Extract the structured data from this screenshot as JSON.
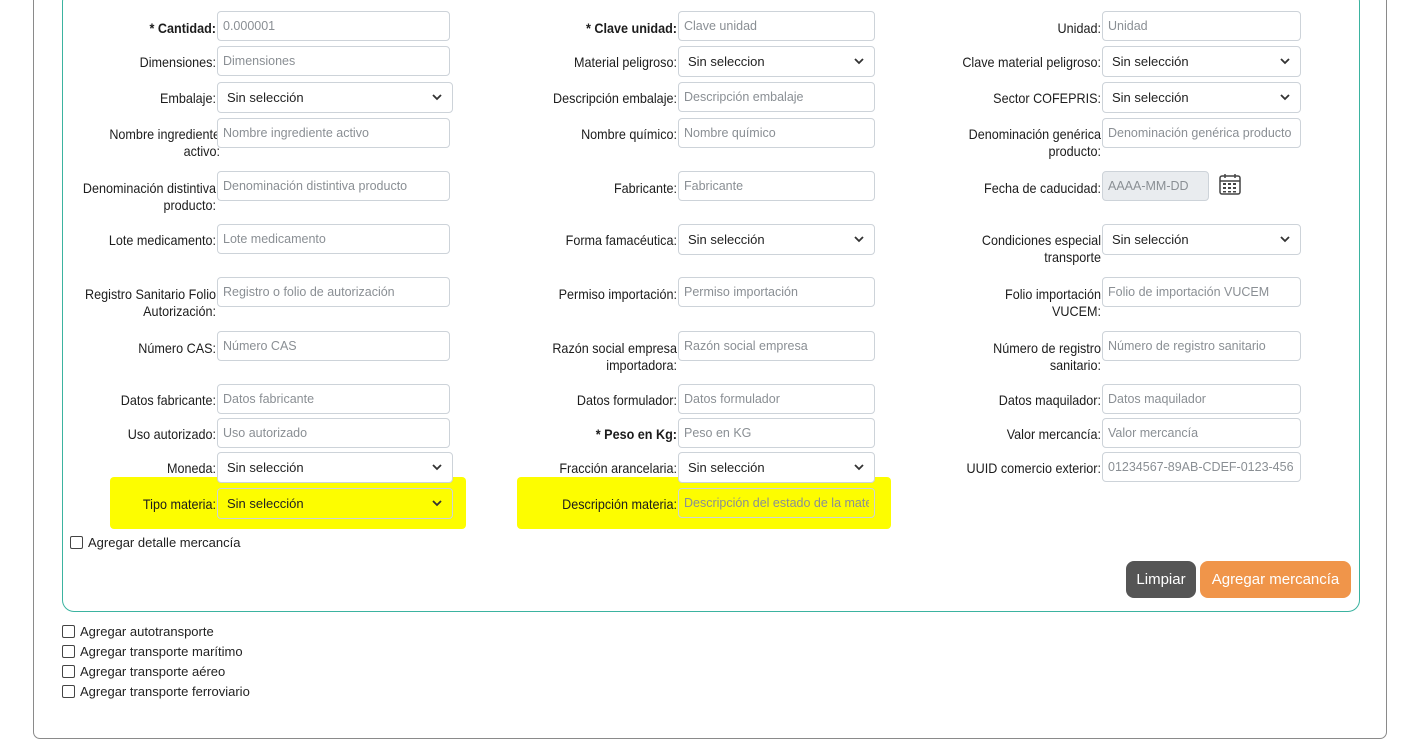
{
  "labels": {
    "cantidad": "* Cantidad:",
    "clave_unidad": "* Clave unidad:",
    "unidad": "Unidad:",
    "dimensiones": "Dimensiones:",
    "material_peligroso": "Material peligroso:",
    "clave_material_peligroso": "Clave material peligroso:",
    "embalaje": "Embalaje:",
    "descripcion_embalaje": "Descripción embalaje:",
    "sector_cofepris": "Sector COFEPRIS:",
    "nombre_ingrediente": "Nombre ingrediente activo:",
    "nombre_quimico": "Nombre químico:",
    "denominacion_generica": "Denominación genérica producto:",
    "denominacion_distintiva": "Denominación distintiva producto:",
    "fabricante": "Fabricante:",
    "fecha_caducidad": "Fecha de caducidad:",
    "lote_medicamento": "Lote medicamento:",
    "forma_farmaceutica": "Forma famacéutica:",
    "condiciones_transporte": "Condiciones especial transporte",
    "registro_sanitario": "Registro Sanitario Folio Autorización:",
    "permiso_importacion": "Permiso importación:",
    "folio_importacion": "Folio importación VUCEM:",
    "numero_cas": "Número CAS:",
    "razon_social": "Razón social empresa importadora:",
    "numero_registro": "Número de registro sanitario:",
    "datos_fabricante": "Datos fabricante:",
    "datos_formulador": "Datos formulador:",
    "datos_maquilador": "Datos maquilador:",
    "uso_autorizado": "Uso autorizado:",
    "peso_kg": "* Peso en Kg:",
    "valor_mercancia": "Valor mercancía:",
    "moneda": "Moneda:",
    "fraccion_arancelaria": "Fracción arancelaria:",
    "uuid_comercio": "UUID comercio exterior:",
    "tipo_materia": "Tipo materia:",
    "descripcion_materia": "Descripción materia:"
  },
  "placeholders": {
    "cantidad": "0.000001",
    "clave_unidad": "Clave unidad",
    "unidad": "Unidad",
    "dimensiones": "Dimensiones",
    "descripcion_embalaje": "Descripción embalaje",
    "nombre_ingrediente": "Nombre ingrediente activo",
    "nombre_quimico": "Nombre químico",
    "denominacion_generica": "Denominación genérica producto",
    "denominacion_distintiva": "Denominación distintiva producto",
    "fabricante": "Fabricante",
    "fecha_caducidad": "AAAA-MM-DD",
    "lote_medicamento": "Lote medicamento",
    "registro_sanitario": "Registro o folio de autorización",
    "permiso_importacion": "Permiso importación",
    "folio_importacion": "Folio de importación VUCEM",
    "numero_cas": "Número CAS",
    "razon_social": "Razón social empresa",
    "numero_registro": "Número de registro sanitario",
    "datos_fabricante": "Datos fabricante",
    "datos_formulador": "Datos formulador",
    "datos_maquilador": "Datos maquilador",
    "uso_autorizado": "Uso autorizado",
    "peso_kg": "Peso en KG",
    "valor_mercancia": "Valor mercancía",
    "uuid_comercio": "01234567-89AB-CDEF-0123-456",
    "descripcion_materia": "Descripción del estado de la mate"
  },
  "selects": {
    "material_peligroso": "Sin seleccion",
    "clave_material_peligroso": "Sin selección",
    "embalaje": "Sin selección",
    "sector_cofepris": "Sin selección",
    "forma_farmaceutica": "Sin selección",
    "condiciones_transporte": "Sin selección",
    "moneda": "Sin selección",
    "fraccion_arancelaria": "Sin selección",
    "tipo_materia": "Sin selección"
  },
  "checkboxes": {
    "detalle_mercancia": "Agregar detalle mercancía",
    "autotransporte": "Agregar autotransporte",
    "transporte_maritimo": "Agregar transporte marítimo",
    "transporte_aereo": "Agregar transporte aéreo",
    "transporte_ferroviario": "Agregar transporte ferroviario"
  },
  "buttons": {
    "limpiar": "Limpiar",
    "agregar_mercancia": "Agregar mercancía"
  },
  "colors": {
    "border_teal": "#3bb3a0",
    "highlight": "#fdfd00",
    "button_gray": "#555555",
    "button_orange": "#f0954a"
  }
}
